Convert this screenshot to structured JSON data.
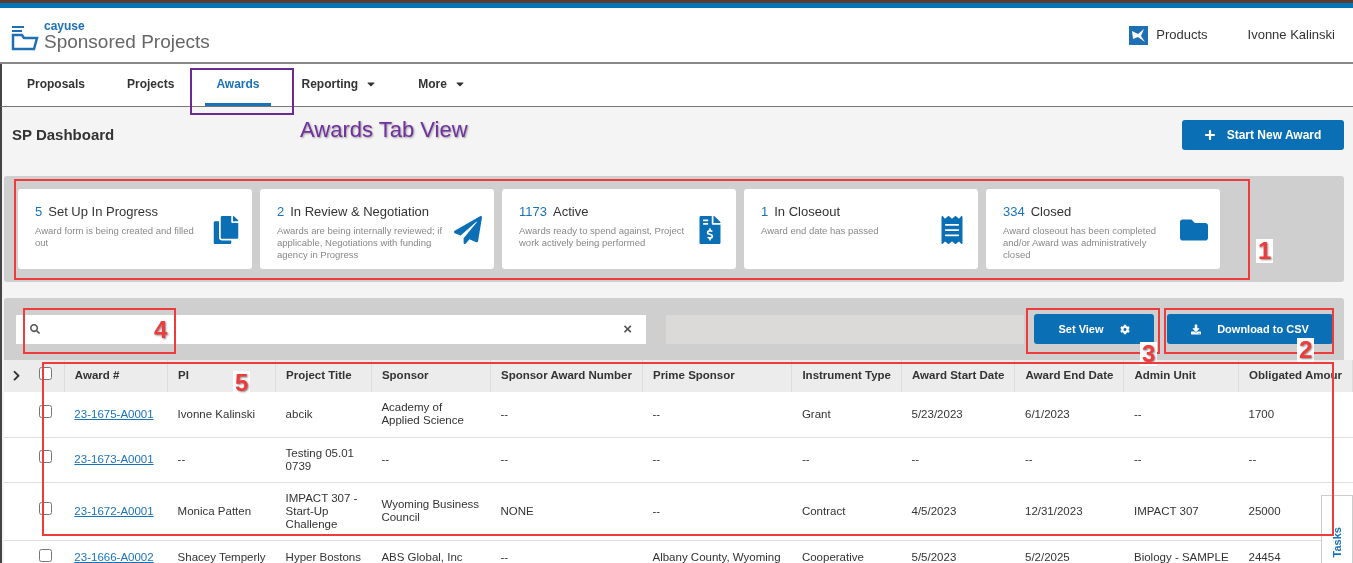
{
  "header": {
    "brand_small": "cayuse",
    "brand": "Sponsored Projects",
    "products": "Products",
    "user": "Ivonne Kalinski"
  },
  "tabs": [
    {
      "label": "Proposals",
      "selected": false,
      "dropdown": false
    },
    {
      "label": "Projects",
      "selected": false,
      "dropdown": false
    },
    {
      "label": "Awards",
      "selected": true,
      "dropdown": false
    },
    {
      "label": "Reporting",
      "selected": false,
      "dropdown": true
    },
    {
      "label": "More",
      "selected": false,
      "dropdown": true
    }
  ],
  "page_title": "SP Dashboard",
  "start_button": "Start New Award",
  "status_cards": [
    {
      "count": "5",
      "title": "Set Up In Progress",
      "description": "Award form is being created and filled out"
    },
    {
      "count": "2",
      "title": "In Review & Negotiation",
      "description": "Awards are being internally reviewed; if applicable, Negotiations with funding agency in Progress"
    },
    {
      "count": "1173",
      "title": "Active",
      "description": "Awards ready to spend against, Project work actively being performed"
    },
    {
      "count": "1",
      "title": "In Closeout",
      "description": "Award end date has passed"
    },
    {
      "count": "334",
      "title": "Closed",
      "description": "Award closeout has been completed and/or Award was administratively closed"
    }
  ],
  "toolbar": {
    "search_clear": "×",
    "set_view": "Set View",
    "download": "Download to CSV"
  },
  "table": {
    "select_all_checked": false,
    "columns": [
      "Award #",
      "PI",
      "Project Title",
      "Sponsor",
      "Sponsor Award Number",
      "Prime Sponsor",
      "Instrument Type",
      "Award Start Date",
      "Award End Date",
      "Admin Unit",
      "Obligated Amour"
    ],
    "rows": [
      {
        "checked": false,
        "cells": [
          "23-1675-A0001",
          "Ivonne Kalinski",
          "abcik",
          "Academy of Applied Science",
          "--",
          "--",
          "Grant",
          "5/23/2023",
          "6/1/2023",
          "--",
          "1700"
        ]
      },
      {
        "checked": false,
        "cells": [
          "23-1673-A0001",
          "--",
          "Testing 05.01 0739",
          "--",
          "--",
          "--",
          "--",
          "--",
          "--",
          "--",
          "--"
        ]
      },
      {
        "checked": false,
        "cells": [
          "23-1672-A0001",
          "Monica Patten",
          "IMPACT 307 - Start-Up Challenge",
          "Wyoming Business Council",
          "NONE",
          "--",
          "Contract",
          "4/5/2023",
          "12/31/2023",
          "IMPACT 307",
          "25000"
        ]
      },
      {
        "checked": false,
        "cells": [
          "23-1666-A0002",
          "Shacey Temperly",
          "Hyper Bostons",
          "ABS Global, Inc",
          "--",
          "Albany County, Wyoming",
          "Cooperative",
          "5/5/2023",
          "5/2/2025",
          "Biology - SAMPLE",
          "24454"
        ]
      }
    ]
  },
  "side_tab": "Tasks",
  "annotations": {
    "tab_caption": "Awards Tab View",
    "markers": [
      "1",
      "4",
      "3",
      "2",
      "5"
    ]
  }
}
